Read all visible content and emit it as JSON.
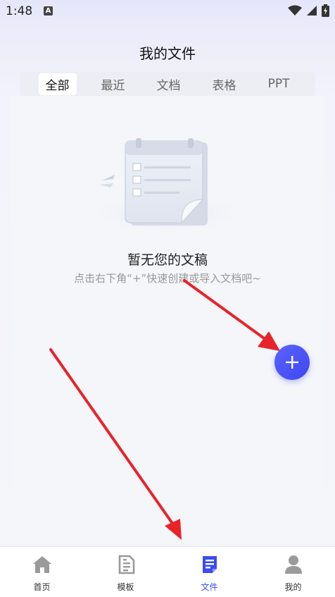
{
  "status_bar": {
    "time": "1:48",
    "a_badge": "A"
  },
  "header": {
    "title": "我的文件"
  },
  "tabs": [
    {
      "label": "全部",
      "active": true
    },
    {
      "label": "最近",
      "active": false
    },
    {
      "label": "文档",
      "active": false
    },
    {
      "label": "表格",
      "active": false
    },
    {
      "label": "PPT",
      "active": false
    }
  ],
  "empty_state": {
    "title": "暂无您的文稿",
    "hint": "点击右下角“+”快速创建或导入文档吧~"
  },
  "fab": {
    "icon": "plus-icon"
  },
  "bottom_nav": [
    {
      "label": "首页",
      "icon": "home-icon",
      "active": false
    },
    {
      "label": "模板",
      "icon": "template-icon",
      "active": false
    },
    {
      "label": "文件",
      "icon": "file-icon",
      "active": true
    },
    {
      "label": "我的",
      "icon": "person-icon",
      "active": false
    }
  ],
  "colors": {
    "accent": "#3c4cf0",
    "arrow": "#e8232a"
  }
}
